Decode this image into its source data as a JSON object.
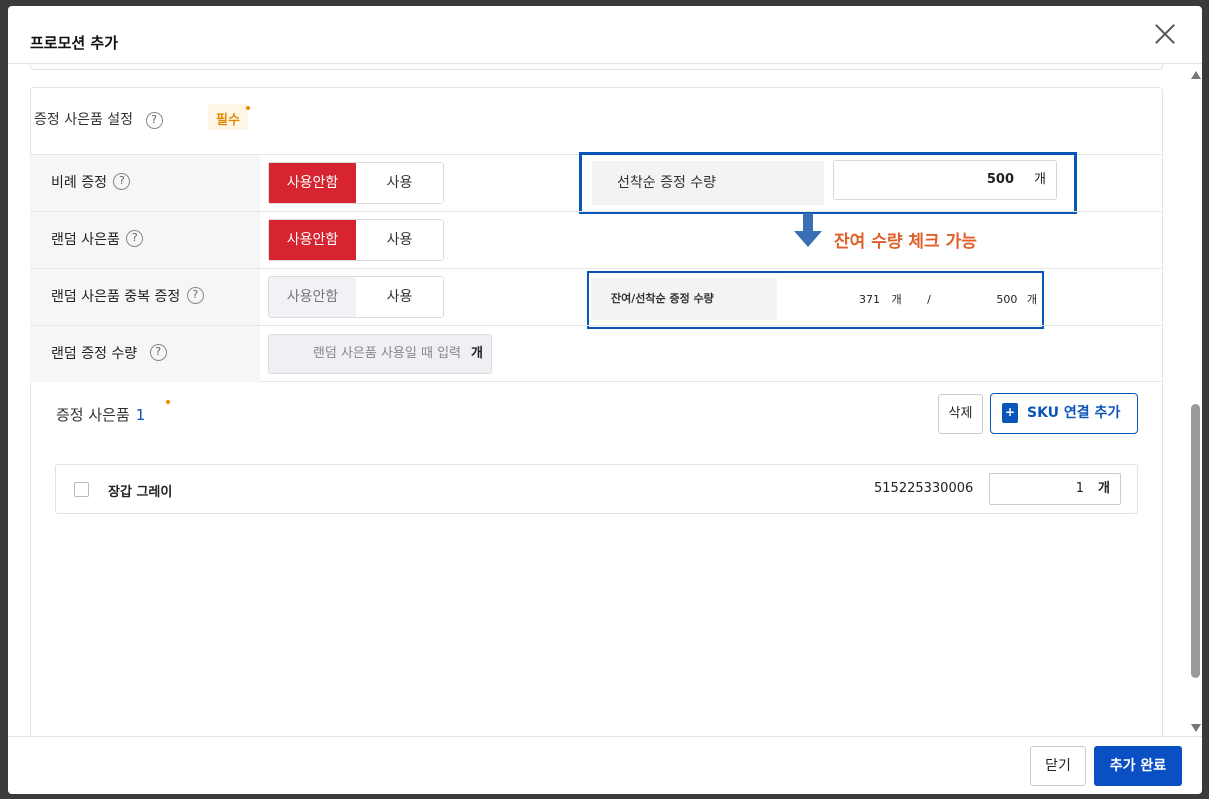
{
  "modal": {
    "title": "프로모션 추가"
  },
  "gift_settings": {
    "title": "증정 사은품 설정",
    "required_label": "필수",
    "help_glyph": "?",
    "rows": [
      {
        "label": "비례 증정",
        "off_label": "사용안함",
        "on_label": "사용",
        "selected": "사용안함",
        "disabled": false
      },
      {
        "label": "랜덤 사은품",
        "off_label": "사용안함",
        "on_label": "사용",
        "selected": "사용안함",
        "disabled": false
      },
      {
        "label": "랜덤 사은품 중복 증정",
        "off_label": "사용안함",
        "on_label": "사용",
        "selected": "사용안함",
        "disabled": true
      },
      {
        "label": "랜덤 증정 수량",
        "placeholder": "랜덤 사은품 사용일 때 입력",
        "unit": "개"
      }
    ],
    "first_come": {
      "label": "선착순 증정 수량",
      "value": "500",
      "unit": "개"
    },
    "annotation": "잔여 수량 체크 가능",
    "remaining": {
      "label": "잔여/선착순 증정 수량",
      "remaining_value": "371",
      "remaining_unit": "개",
      "separator": "/",
      "total_value": "500",
      "total_unit": "개"
    }
  },
  "gifts": {
    "title": "증정 사은품",
    "count": "1",
    "delete_label": "삭제",
    "add_sku_label": "SKU 연결 추가",
    "items": [
      {
        "name": "장갑 그레이",
        "sku": "515225330006",
        "quantity": "1",
        "unit": "개"
      }
    ]
  },
  "footer": {
    "close_label": "닫기",
    "complete_label": "추가 완료"
  },
  "colors": {
    "active_toggle": "#d62430",
    "primary": "#0a4fc4",
    "highlight_border": "#0a56b8",
    "annotation": "#e0602a",
    "required": "#e38b00"
  }
}
